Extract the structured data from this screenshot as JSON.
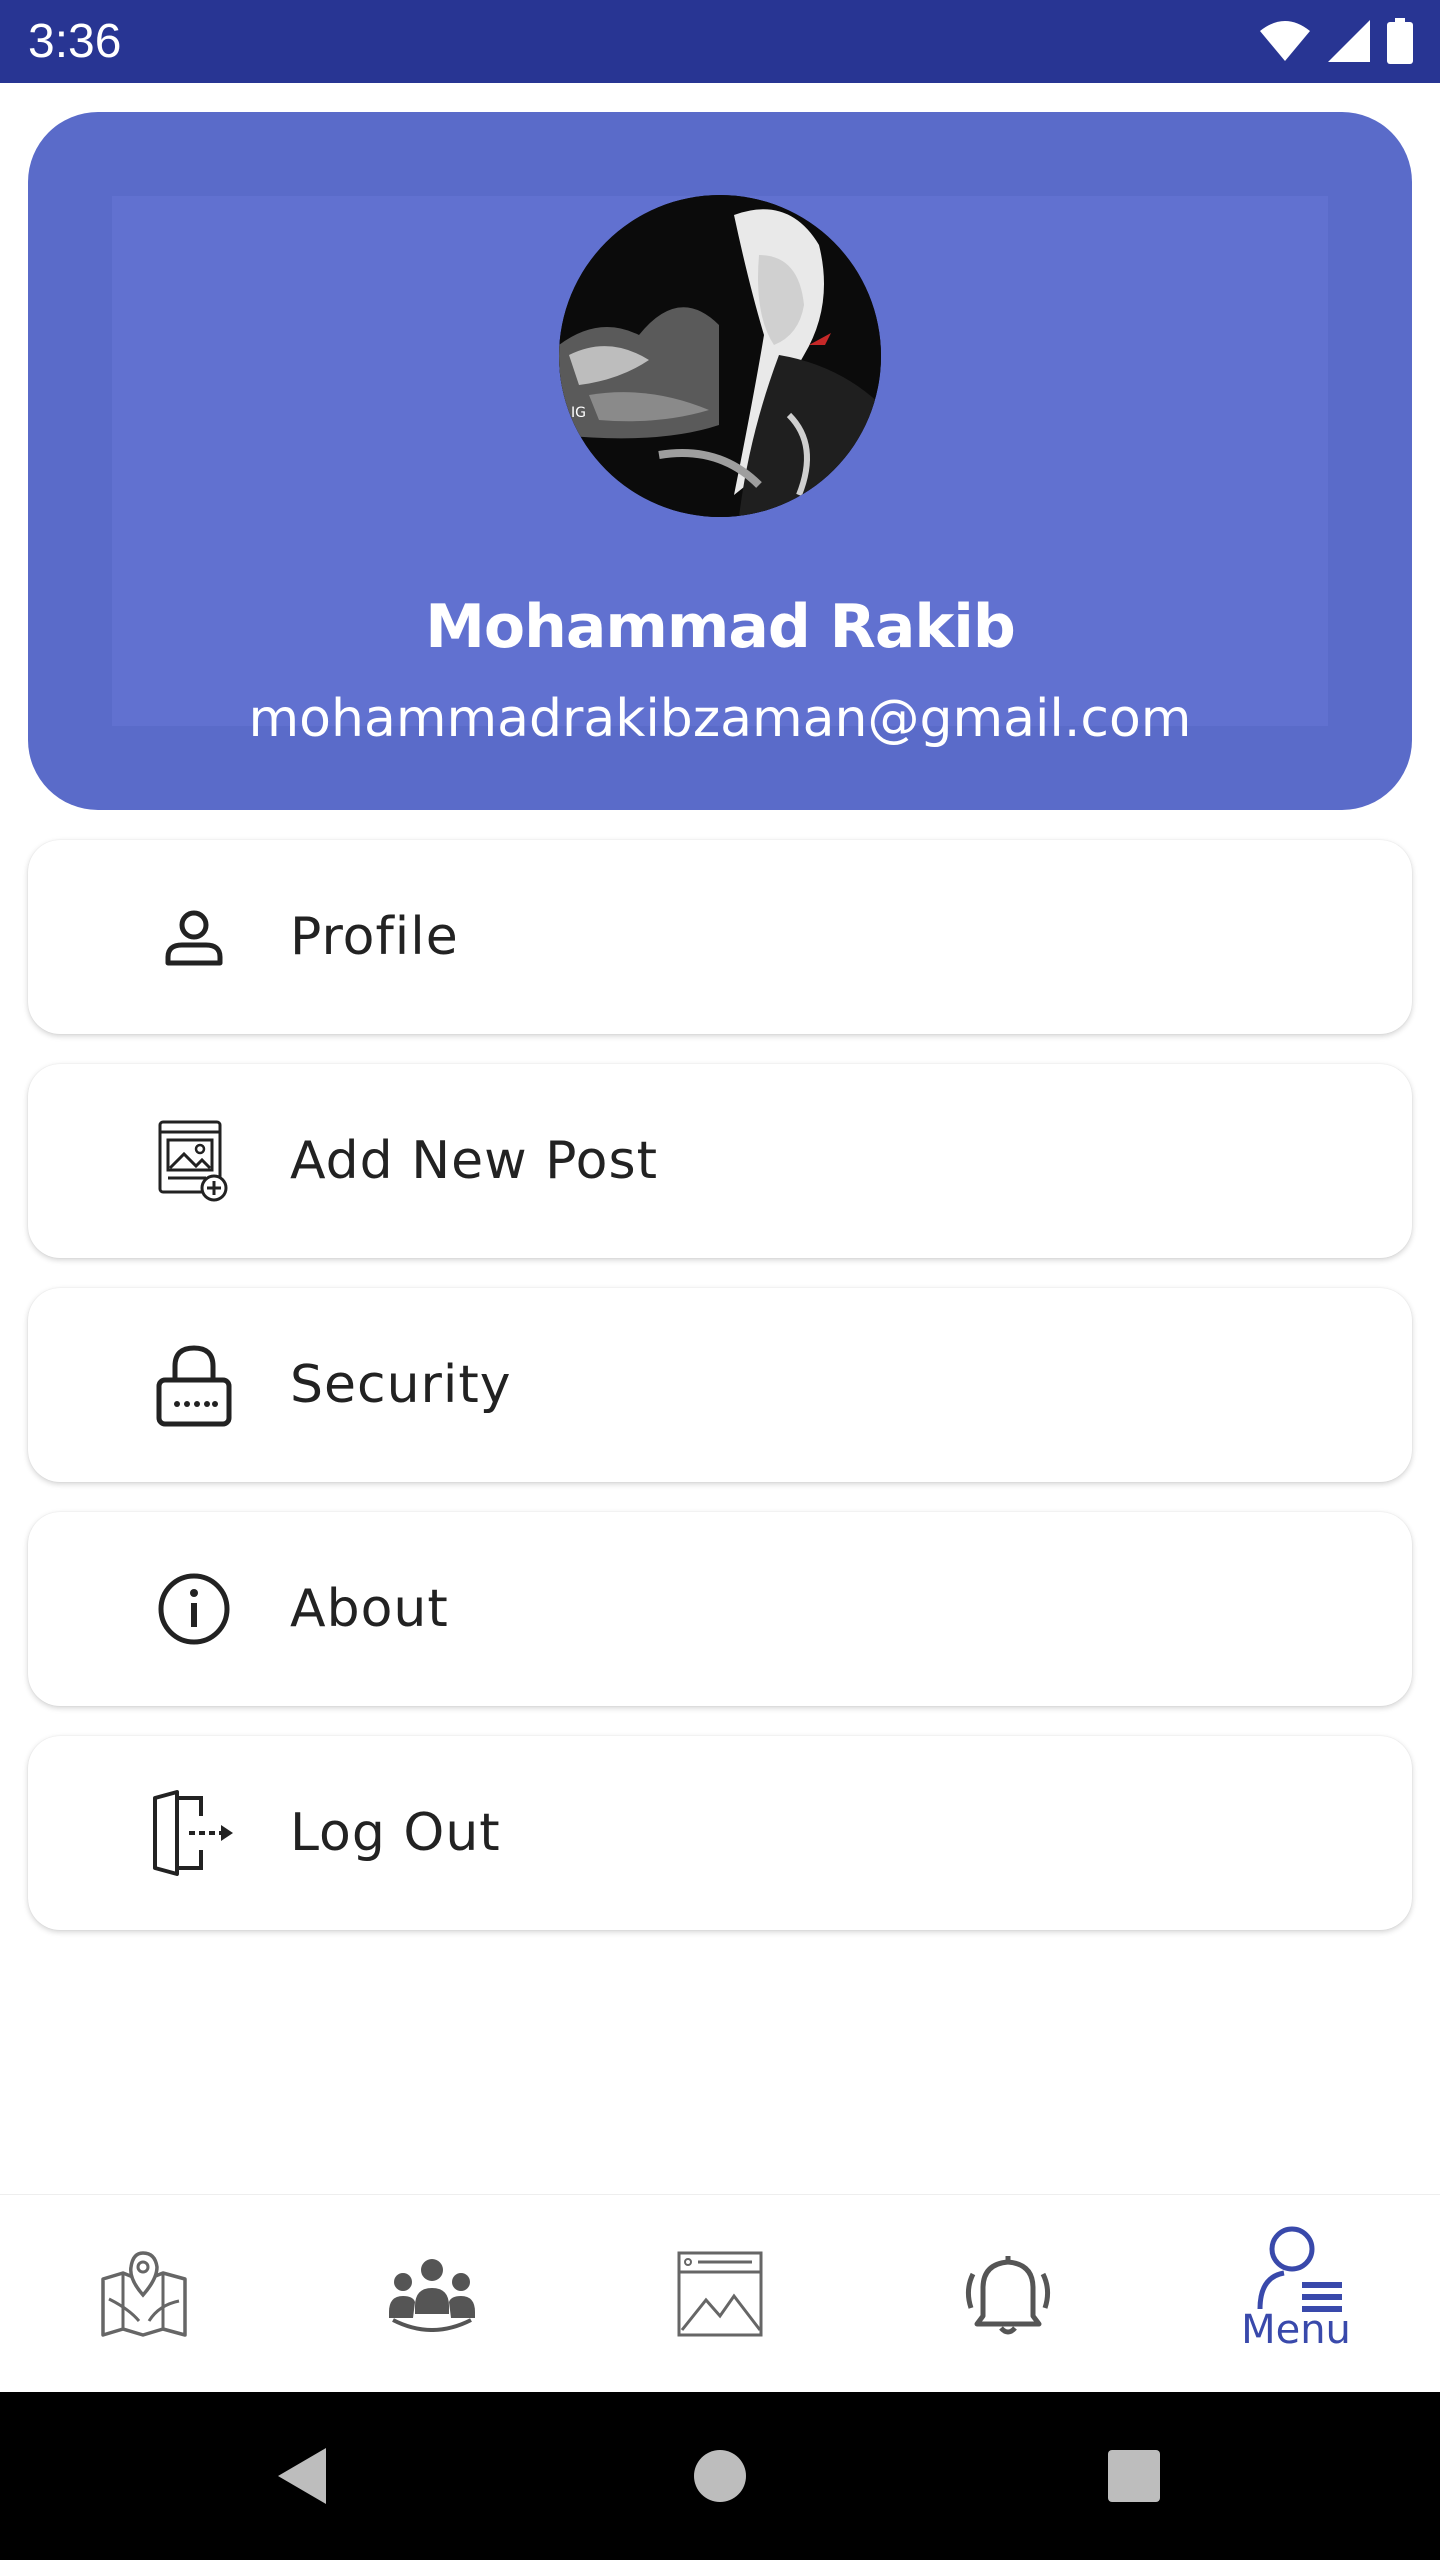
{
  "status_bar": {
    "time": "3:36",
    "icons": [
      "wifi-icon",
      "signal-icon",
      "battery-icon"
    ],
    "color": "#283593"
  },
  "header": {
    "name": "Mohammad Rakib",
    "email": "mohammadrakibzaman@gmail.com",
    "background": "#5a6bc9"
  },
  "menu": {
    "items": [
      {
        "label": "Profile",
        "icon": "person-icon"
      },
      {
        "label": "Add New Post",
        "icon": "add-image-post-icon"
      },
      {
        "label": "Security",
        "icon": "lock-icon"
      },
      {
        "label": "About",
        "icon": "info-icon"
      },
      {
        "label": "Log Out",
        "icon": "logout-icon"
      }
    ]
  },
  "bottom_nav": {
    "items": [
      {
        "icon": "map-icon"
      },
      {
        "icon": "group-icon"
      },
      {
        "icon": "image-feed-icon"
      },
      {
        "icon": "bell-icon"
      },
      {
        "icon": "user-menu-icon",
        "label": "Menu",
        "selected": true
      }
    ],
    "accent": "#3949ab"
  },
  "system_nav": {
    "icons": [
      "back-icon",
      "home-icon",
      "recents-icon"
    ]
  }
}
